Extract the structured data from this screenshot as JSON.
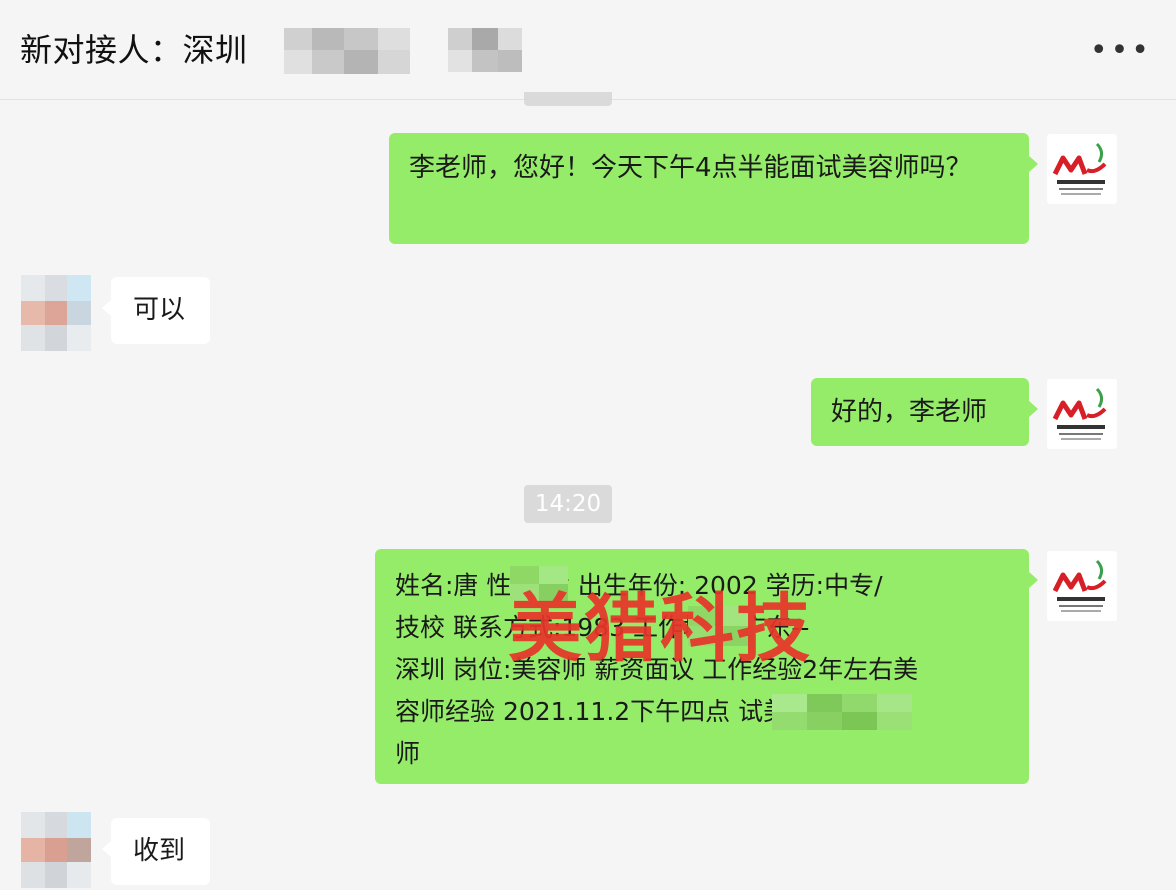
{
  "header": {
    "title_prefix": "新对接人：深圳",
    "title_name_start": "李",
    "more_icon": "more-icon"
  },
  "colors": {
    "background": "#f5f5f5",
    "sent_bubble": "#95ec69",
    "received_bubble": "#ffffff",
    "timestamp_bg": "#dadada",
    "watermark": "#e8342a"
  },
  "messages": [
    {
      "from": "me",
      "text": "李老师，您好！今天下午4点半能面试美容师吗？"
    },
    {
      "from": "them",
      "text": "可以"
    },
    {
      "from": "me",
      "text": "好的，李老师"
    },
    {
      "type": "timestamp",
      "text": "14:20"
    },
    {
      "from": "me",
      "lines": [
        "姓名:唐  性别:女 出生年份: 2002 学历:中专/",
        "技校 联系方式:1983  工作地点:广东--",
        "深圳 岗位:美容师 薪资面议 工作经验2年左右美",
        "容师经验 2021.11.2下午四点  试美容",
        "师"
      ]
    },
    {
      "from": "them",
      "text": "收到"
    }
  ],
  "watermark": "美猎科技"
}
